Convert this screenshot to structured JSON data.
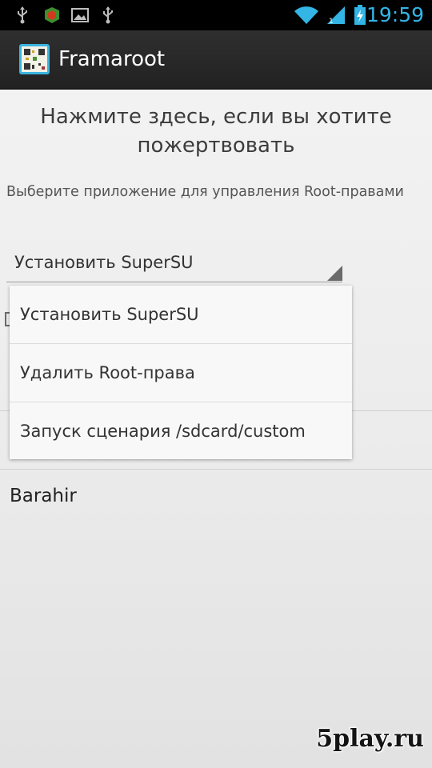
{
  "status_bar": {
    "time": "19:59",
    "icons": [
      "usb-icon",
      "security-app-icon",
      "image-icon",
      "usb-icon",
      "wifi-icon",
      "signal-icon",
      "battery-charging-icon"
    ]
  },
  "action_bar": {
    "title": "Framaroot",
    "icon": "qr-app-icon"
  },
  "main": {
    "donate_text": "Нажмите здесь, если вы хотите пожертвовать",
    "select_label": "Выберите приложение для управления Root-правами",
    "spinner_value": "Установить SuperSU",
    "author": "Barahir"
  },
  "dropdown": {
    "options": [
      "Установить SuperSU",
      "Удалить Root-права",
      "Запуск сценария /sdcard/custom"
    ]
  },
  "watermark": "5play.ru",
  "colors": {
    "status_time": "#33b5e5",
    "action_bar_bg": "#2a2a2a",
    "background": "#f0f0f0"
  }
}
